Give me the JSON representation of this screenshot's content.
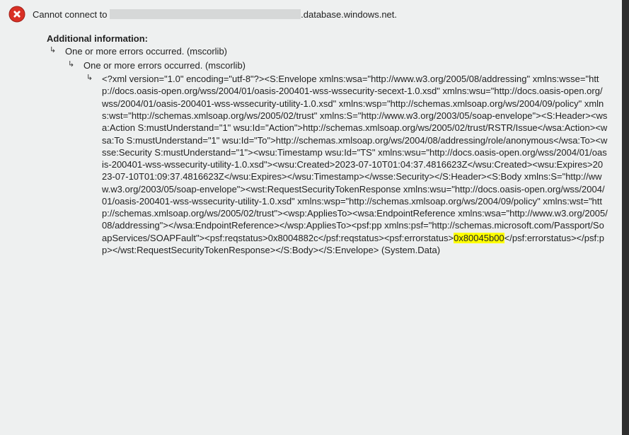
{
  "error_icon": "error-icon",
  "message_prefix": "Cannot connect to ",
  "message_suffix": ".database.windows.net.",
  "additional_heading": "Additional information:",
  "nodes": {
    "l1": "One or more errors occurred. (mscorlib)",
    "l2": "One or more errors occurred. (mscorlib)"
  },
  "xml": {
    "pre": "<?xml version=\"1.0\" encoding=\"utf-8\"?><S:Envelope xmlns:wsa=\"http://www.w3.org/2005/08/addressing\" xmlns:wsse=\"http://docs.oasis-open.org/wss/2004/01/oasis-200401-wss-wssecurity-secext-1.0.xsd\" xmlns:wsu=\"http://docs.oasis-open.org/wss/2004/01/oasis-200401-wss-wssecurity-utility-1.0.xsd\" xmlns:wsp=\"http://schemas.xmlsoap.org/ws/2004/09/policy\" xmlns:wst=\"http://schemas.xmlsoap.org/ws/2005/02/trust\" xmlns:S=\"http://www.w3.org/2003/05/soap-envelope\"><S:Header><wsa:Action S:mustUnderstand=\"1\" wsu:Id=\"Action\">http://schemas.xmlsoap.org/ws/2005/02/trust/RSTR/Issue</wsa:Action><wsa:To S:mustUnderstand=\"1\" wsu:Id=\"To\">http://schemas.xmlsoap.org/ws/2004/08/addressing/role/anonymous</wsa:To><wsse:Security S:mustUnderstand=\"1\"><wsu:Timestamp wsu:Id=\"TS\" xmlns:wsu=\"http://docs.oasis-open.org/wss/2004/01/oasis-200401-wss-wssecurity-utility-1.0.xsd\"><wsu:Created>2023-07-10T01:04:37.4816623Z</wsu:Created><wsu:Expires>2023-07-10T01:09:37.4816623Z</wsu:Expires></wsu:Timestamp></wsse:Security></S:Header><S:Body xmlns:S=\"http://www.w3.org/2003/05/soap-envelope\"><wst:RequestSecurityTokenResponse xmlns:wsu=\"http://docs.oasis-open.org/wss/2004/01/oasis-200401-wss-wssecurity-utility-1.0.xsd\" xmlns:wsp=\"http://schemas.xmlsoap.org/ws/2004/09/policy\" xmlns:wst=\"http://schemas.xmlsoap.org/ws/2005/02/trust\"><wsp:AppliesTo><wsa:EndpointReference xmlns:wsa=\"http://www.w3.org/2005/08/addressing\"></wsa:EndpointReference></wsp:AppliesTo><psf:pp xmlns:psf=\"http://schemas.microsoft.com/Passport/SoapServices/SOAPFault\"><psf:reqstatus>0x8004882c</psf:reqstatus><psf:errorstatus>",
    "highlight": "0x80045b00",
    "post": "</psf:errorstatus></psf:pp></wst:RequestSecurityTokenResponse></S:Body></S:Envelope> (System.Data)"
  },
  "arrow_glyph": "↳"
}
